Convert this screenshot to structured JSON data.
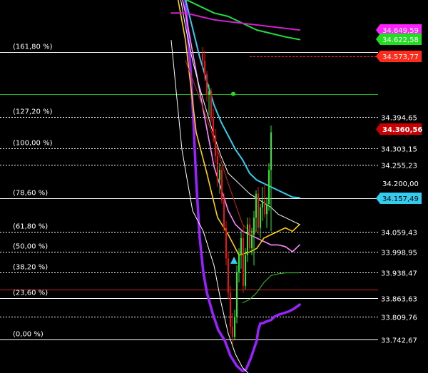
{
  "chart_data": {
    "type": "line",
    "title": "",
    "xlabel": "",
    "ylabel": "",
    "y_axis_side": "right",
    "ylim": [
      33700,
      34720
    ],
    "plain_ticks": [
      {
        "value": 34200.0,
        "label": "34.200,00"
      }
    ],
    "fibonacci_levels": [
      {
        "label": "(161,80 %)",
        "value": 34584.9,
        "color": "#ffffff",
        "style": "solid"
      },
      {
        "label": "(127,20 %)",
        "value": 34394.65,
        "price_label": "34.394,65",
        "color": "#ffffff",
        "style": "dotted"
      },
      {
        "label": "(100,00 %)",
        "value": 34303.15,
        "price_label": "34.303,15",
        "color": "#ffffff",
        "style": "dotted"
      },
      {
        "label": "(78,60 %)",
        "value": 34157.49,
        "color": "#ffffff",
        "style": "solid"
      },
      {
        "label": "(61,80 %)",
        "value": 34059.43,
        "price_label": "34.059,43",
        "color": "#ffffff",
        "style": "dotted"
      },
      {
        "label": "(50,00 %)",
        "value": 33998.95,
        "price_label": "33.998,95",
        "color": "#ffffff",
        "style": "dotted"
      },
      {
        "label": "(38,20 %)",
        "value": 33938.47,
        "price_label": "33.938,47",
        "color": "#ffffff",
        "style": "dotted"
      },
      {
        "label": "(23,60 %)",
        "value": 33863.63,
        "price_label": "33.863,63",
        "color": "#ffffff",
        "style": "solid"
      },
      {
        "label": "(0,00 %)",
        "value": 33742.67,
        "price_label": "33.742,67",
        "color": "#ffffff",
        "style": "solid"
      }
    ],
    "extra_price_labels": [
      {
        "value": 34255.23,
        "label": "34.255,23",
        "style": "dotted"
      },
      {
        "value": 33809.76,
        "label": "33.809,76",
        "style": "dotted"
      }
    ],
    "other_lines": [
      {
        "value": 34463,
        "color": "#22aa22"
      },
      {
        "value": 33890,
        "color": "#cc2222"
      },
      {
        "value": 34573.77,
        "color": "#ff2222",
        "dashed": true
      }
    ],
    "badges": [
      {
        "label": "34.649,59",
        "value": 34649.59,
        "color": "#ff22ff",
        "text_color": "#ffffff"
      },
      {
        "label": "34.622,58",
        "value": 34622.58,
        "color": "#22dd22",
        "text_color": "#ffffff"
      },
      {
        "label": "34.573,77",
        "value": 34573.77,
        "color": "#ff2a1a",
        "text_color": "#ffffff"
      },
      {
        "label": "34.360,56",
        "value": 34360.56,
        "color": "#cc0000",
        "text_color": "#ffffff",
        "bold": true
      },
      {
        "label": "34.157,49",
        "value": 34157.49,
        "color": "#33ccee",
        "text_color": "#000000"
      }
    ],
    "series": [
      {
        "color": "#9922ff",
        "width": 3.5,
        "x": [
          0,
          12,
          18,
          22,
          27,
          31,
          35,
          40,
          45,
          50,
          58,
          66,
          75,
          83,
          92,
          100,
          105,
          112,
          116,
          120,
          122,
          125,
          128,
          133,
          140,
          145,
          150,
          158,
          165,
          170,
          177,
          180
        ],
        "y": [
          34860,
          34860,
          34790,
          34680,
          34540,
          34390,
          34210,
          34040,
          33940,
          33880,
          33820,
          33770,
          33740,
          33695,
          33665,
          33650,
          33655,
          33690,
          33715,
          33740,
          33770,
          33790,
          33790,
          33795,
          33800,
          33810,
          33815,
          33820,
          33825,
          33830,
          33840,
          33845
        ]
      },
      {
        "color": "#33ccee",
        "width": 2,
        "x": [
          0,
          20,
          40,
          50,
          60,
          70,
          80,
          90,
          100,
          110,
          120,
          130,
          140,
          150,
          160,
          170,
          180
        ],
        "y": [
          34880,
          34740,
          34570,
          34500,
          34430,
          34380,
          34340,
          34300,
          34270,
          34230,
          34210,
          34200,
          34190,
          34180,
          34170,
          34160,
          34158
        ]
      },
      {
        "color": "#ff88ff",
        "width": 1.6,
        "x": [
          0,
          20,
          40,
          60,
          80,
          90,
          100,
          110,
          120,
          130,
          140,
          150,
          160,
          170,
          180
        ],
        "y": [
          34890,
          34700,
          34470,
          34250,
          34120,
          34080,
          34060,
          34050,
          34040,
          34030,
          34020,
          34020,
          34015,
          34000,
          34020
        ]
      },
      {
        "color": "#ffd000",
        "width": 1.6,
        "x": [
          0,
          20,
          35,
          50,
          65,
          80,
          95,
          110,
          120,
          130,
          140,
          150,
          160,
          170,
          180
        ],
        "y": [
          34850,
          34620,
          34350,
          34230,
          34100,
          34050,
          33990,
          33999,
          34010,
          34040,
          34050,
          34060,
          34070,
          34060,
          34080
        ]
      },
      {
        "color": "#ffffff",
        "width": 1,
        "x": [
          0,
          10,
          20,
          30,
          40,
          50,
          60,
          70,
          80,
          95,
          110,
          125,
          140,
          150,
          160,
          170,
          180
        ],
        "y": [
          34880,
          34780,
          34660,
          34560,
          34480,
          34410,
          34340,
          34280,
          34230,
          34200,
          34170,
          34150,
          34130,
          34110,
          34100,
          34090,
          34080
        ]
      },
      {
        "color": "#ffffff",
        "width": 1,
        "x": [
          0,
          15,
          30,
          45,
          60,
          70,
          80,
          90,
          100,
          110,
          120,
          130,
          140,
          150,
          160,
          170,
          180
        ],
        "y": [
          34620,
          34300,
          34120,
          34060,
          33960,
          33850,
          33760,
          33700,
          33660,
          33640,
          33620,
          33610,
          33600,
          33610,
          33620,
          33630,
          33640
        ]
      },
      {
        "color": "#22dd44",
        "width": 2,
        "x": [
          0,
          20,
          40,
          60,
          80,
          100,
          120,
          140,
          160,
          180
        ],
        "y": [
          34760,
          34740,
          34720,
          34700,
          34690,
          34670,
          34650,
          34640,
          34630,
          34622
        ]
      },
      {
        "color": "#cc22cc",
        "width": 2,
        "x": [
          0,
          20,
          40,
          60,
          80,
          100,
          120,
          140,
          160,
          180
        ],
        "y": [
          34700,
          34700,
          34690,
          34680,
          34675,
          34670,
          34665,
          34660,
          34655,
          34650
        ]
      },
      {
        "color": "#33cc22",
        "width": 1,
        "x": [
          100,
          110,
          120,
          130,
          140,
          150,
          160,
          170,
          180
        ],
        "y": [
          33850,
          33860,
          33880,
          33910,
          33930,
          33935,
          33938,
          33938,
          33938
        ]
      },
      {
        "color": "#cc2222",
        "width": 1,
        "x": [
          20,
          40,
          60,
          80,
          100,
          110,
          120
        ],
        "y": [
          34560,
          34450,
          34330,
          34200,
          34080,
          34060,
          34060
        ]
      }
    ],
    "candles": {
      "x_range": [
        0,
        180
      ],
      "ohlc": [
        [
          44,
          34580,
          34600,
          34540,
          34560
        ],
        [
          47,
          34560,
          34590,
          34500,
          34520
        ],
        [
          50,
          34520,
          34530,
          34440,
          34460
        ],
        [
          53,
          34460,
          34490,
          34400,
          34470
        ],
        [
          56,
          34470,
          34480,
          34380,
          34390
        ],
        [
          59,
          34390,
          34420,
          34320,
          34340
        ],
        [
          62,
          34340,
          34360,
          34260,
          34280
        ],
        [
          65,
          34280,
          34300,
          34190,
          34210
        ],
        [
          68,
          34210,
          34260,
          34170,
          34240
        ],
        [
          71,
          34240,
          34250,
          34140,
          34150
        ],
        [
          74,
          34150,
          34170,
          34060,
          34070
        ],
        [
          77,
          34070,
          34090,
          33960,
          33980
        ],
        [
          80,
          33980,
          34000,
          33860,
          33880
        ],
        [
          83,
          33880,
          33900,
          33760,
          33780
        ],
        [
          86,
          33780,
          33820,
          33730,
          33750
        ],
        [
          89,
          33750,
          33830,
          33740,
          33810
        ],
        [
          92,
          33810,
          33960,
          33790,
          33940
        ],
        [
          95,
          33940,
          34010,
          33910,
          33990
        ],
        [
          98,
          33990,
          34060,
          33950,
          34040
        ],
        [
          101,
          34040,
          34080,
          33880,
          33900
        ],
        [
          104,
          33900,
          34010,
          33890,
          33990
        ],
        [
          107,
          33990,
          34100,
          33970,
          34080
        ],
        [
          110,
          34080,
          34100,
          34000,
          34010
        ],
        [
          113,
          34010,
          34070,
          33990,
          34050
        ],
        [
          116,
          34050,
          34120,
          33960,
          34100
        ],
        [
          119,
          34100,
          34180,
          34060,
          34170
        ],
        [
          122,
          34170,
          34190,
          34050,
          34070
        ],
        [
          125,
          34070,
          34140,
          34040,
          34130
        ],
        [
          128,
          34130,
          34190,
          34090,
          34150
        ],
        [
          131,
          34150,
          34200,
          34100,
          34110
        ],
        [
          134,
          34110,
          34160,
          34070,
          34140
        ],
        [
          137,
          34140,
          34260,
          34120,
          34240
        ],
        [
          140,
          34240,
          34370,
          34060,
          34350
        ]
      ]
    },
    "markers": [
      {
        "shape": "triangle-up",
        "x": 88,
        "value": 33975,
        "color": "#33ccee"
      },
      {
        "shape": "dot",
        "x": 87,
        "value": 34463,
        "color": "#22dd22"
      }
    ]
  }
}
